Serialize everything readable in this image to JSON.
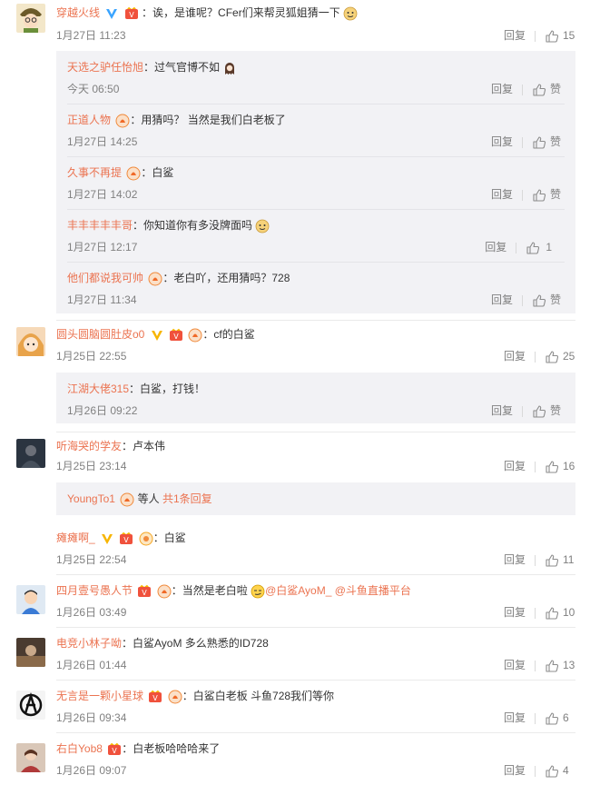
{
  "labels": {
    "reply": "回复",
    "like": "赞"
  },
  "c1": {
    "user": "穿越火线",
    "text": "：诶，是谁呢？CFer们来帮灵狐姐猜一下",
    "time": "1月27日 11:23",
    "likes": "15"
  },
  "c1s1": {
    "user": "天选之驴任怡旭",
    "text": "：过气官博不如",
    "time": "今天 06:50"
  },
  "c1s2": {
    "user": "正道人物",
    "text": "：用猜吗？ 当然是我们白老板了",
    "time": "1月27日 14:25"
  },
  "c1s3": {
    "user": "久事不再提",
    "text": "：白鲨",
    "time": "1月27日 14:02"
  },
  "c1s4": {
    "user": "丰丰丰丰丰哥",
    "text": "：你知道你有多没牌面吗",
    "time": "1月27日 12:17",
    "likes": "1"
  },
  "c1s5": {
    "user": "他们都说我可帅",
    "text": "：老白吖，还用猜吗？728",
    "time": "1月27日 11:34"
  },
  "c2": {
    "user": "圆头圆脑圆肚皮o0",
    "text": "：cf的白鲨",
    "time": "1月25日 22:55",
    "likes": "25"
  },
  "c2s1": {
    "user": "江湖大佬315",
    "text": "：白鲨，打钱！",
    "time": "1月26日 09:22"
  },
  "c3": {
    "user": "听海哭的学友",
    "text": "：卢本伟",
    "time": "1月25日 23:14",
    "likes": "16"
  },
  "c3s1": {
    "user": "YoungTo1",
    "text": " 等人 ",
    "more": "共1条回复"
  },
  "c4": {
    "user": "瘫瘫啊_",
    "text": "：白鲨",
    "time": "1月25日 22:54",
    "likes": "11"
  },
  "c5": {
    "user": "四月壹号愚人节",
    "text": "：当然是老白啦",
    "mention1": "@白鲨AyoM_",
    "mention2": "@斗鱼直播平台",
    "time": "1月26日 03:49",
    "likes": "10"
  },
  "c6": {
    "user": "电竞小林子呦",
    "text": "：白鲨AyoM  多么熟悉的ID728",
    "time": "1月26日 01:44",
    "likes": "13"
  },
  "c7": {
    "user": "无言是一颗小星球",
    "text": "：白鲨白老板  斗鱼728我们等你",
    "time": "1月26日 09:34",
    "likes": "6"
  },
  "c8": {
    "user": "右白Yob8",
    "text": "：白老板哈哈哈来了",
    "time": "1月26日 09:07",
    "likes": "4"
  },
  "colors": {
    "username": "#eb7350",
    "meta": "#808080",
    "subbg": "#f2f2f5"
  }
}
